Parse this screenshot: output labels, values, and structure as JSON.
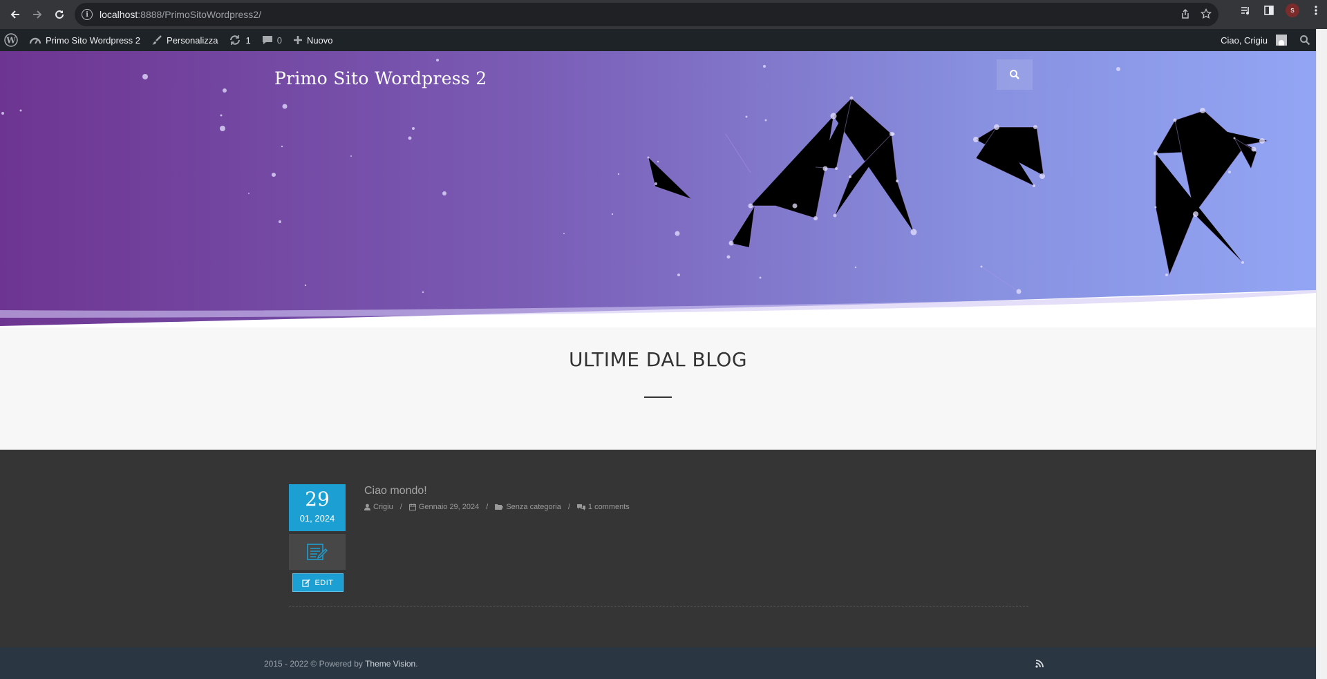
{
  "browser": {
    "url_host": "localhost",
    "url_path": ":8888/PrimoSitoWordpress2/",
    "profile_initial": "s"
  },
  "adminbar": {
    "site_name": "Primo Sito Wordpress 2",
    "customize": "Personalizza",
    "updates_count": "1",
    "comments_count": "0",
    "new_label": "Nuovo",
    "greeting": "Ciao, Crigiu"
  },
  "hero": {
    "site_title": "Primo Sito Wordpress 2"
  },
  "section": {
    "title": "ULTIME DAL BLOG"
  },
  "post": {
    "day": "29",
    "month_year": "01, 2024",
    "edit_label": "EDIT",
    "title": "Ciao mondo!",
    "author": "Crigiu",
    "date": "Gennaio 29, 2024",
    "category": "Senza categoria",
    "comments": "1 comments"
  },
  "footer": {
    "text_prefix": "2015 - 2022 © Powered by ",
    "link": "Theme Vision",
    "text_suffix": "."
  },
  "colors": {
    "accent": "#1c9fd2",
    "adminbar": "#1d2327",
    "footer": "#2a3641"
  }
}
